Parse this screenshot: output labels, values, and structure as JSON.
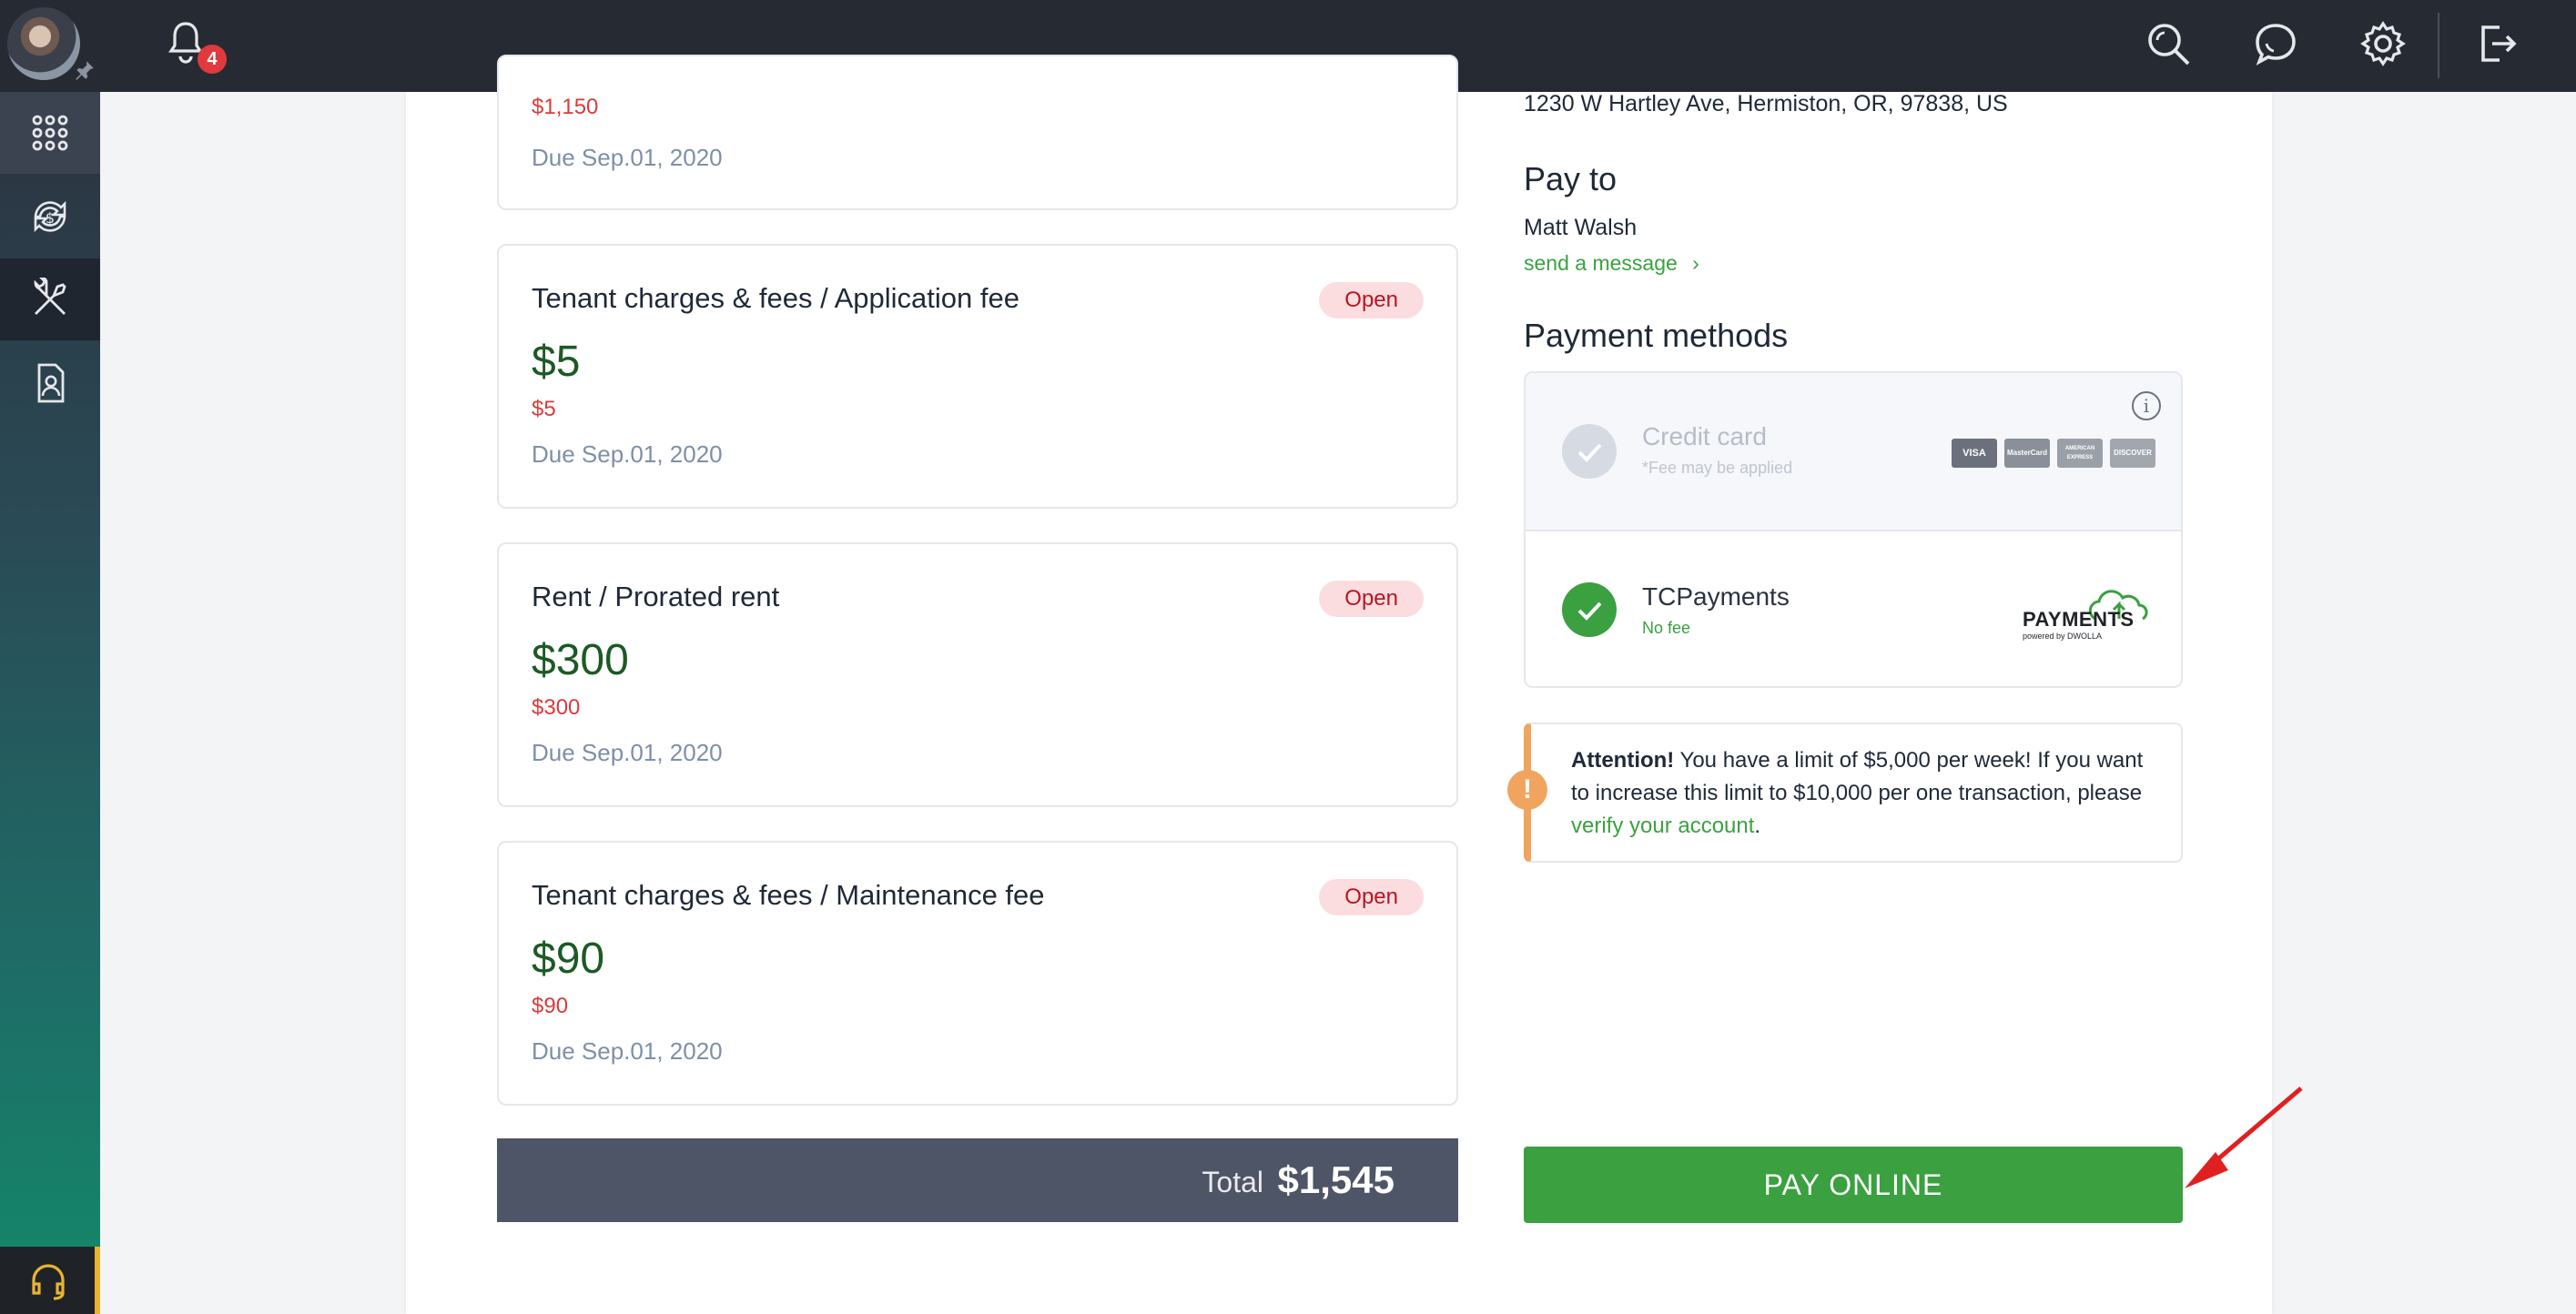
{
  "topbar": {
    "notification_count": "4",
    "icons": [
      "search-icon",
      "chat-icon",
      "gear-icon",
      "logout-icon"
    ]
  },
  "sidebar": {
    "items": [
      {
        "name": "apps-grid-icon"
      },
      {
        "name": "payments-cycle-icon"
      },
      {
        "name": "maintenance-tools-icon"
      },
      {
        "name": "tenant-profile-icon"
      }
    ],
    "support_icon": "headset-icon"
  },
  "charges": {
    "top_partial": {
      "amount_sub": "$1,150",
      "due": "Due Sep.01, 2020"
    },
    "cards": [
      {
        "title": "Tenant charges & fees /  Application fee",
        "status": "Open",
        "amount": "$5",
        "amount_sub": "$5",
        "due": "Due Sep.01, 2020"
      },
      {
        "title": "Rent /  Prorated rent",
        "status": "Open",
        "amount": "$300",
        "amount_sub": "$300",
        "due": "Due Sep.01, 2020"
      },
      {
        "title": "Tenant charges & fees /  Maintenance fee",
        "status": "Open",
        "amount": "$90",
        "amount_sub": "$90",
        "due": "Due Sep.01, 2020"
      }
    ],
    "total_label": "Total",
    "total_value": "$1,545"
  },
  "right": {
    "address": "1230 W Hartley Ave, Hermiston, OR, 97838, US",
    "pay_to_heading": "Pay to",
    "payee": "Matt Walsh",
    "send_message": "send a message",
    "payment_methods_heading": "Payment methods",
    "methods": [
      {
        "name": "Credit card",
        "sub": "*Fee may be applied",
        "logos": [
          "VISA",
          "MasterCard",
          "AMERICAN EXPRESS",
          "DISCOVER"
        ]
      },
      {
        "name": "TCPayments",
        "sub": "No fee",
        "logo_text": "PAYMENTS",
        "logo_sub": "powered by DWOLLA"
      }
    ],
    "attention_bold": "Attention!",
    "attention_text": " You have a limit of $5,000 per week! If you want to increase this limit to $10,000 per one transaction, please ",
    "attention_link": "verify your account",
    "attention_end": ".",
    "pay_button": "PAY ONLINE"
  },
  "colors": {
    "accent_green": "#3aa040",
    "open_pill_bg": "#fbdde0",
    "total_bar": "#4e5566",
    "warning": "#f0a45d"
  }
}
